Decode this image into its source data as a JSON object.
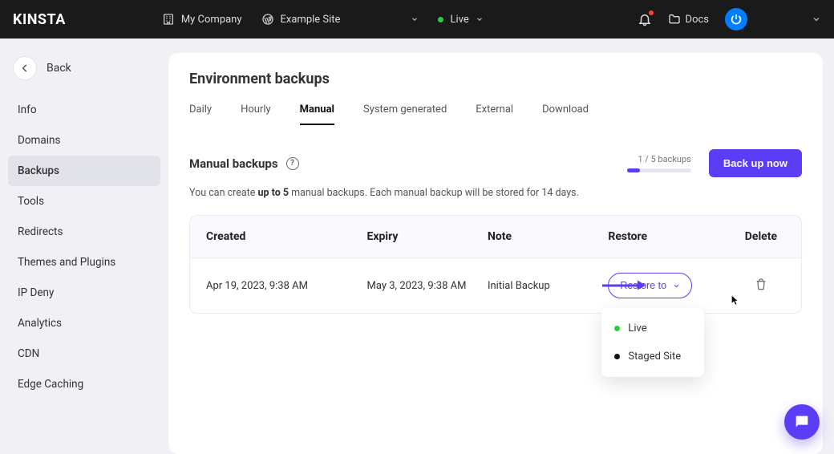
{
  "header": {
    "logo": "KINSTA",
    "company": "My Company",
    "site": "Example Site",
    "env": "Live",
    "docs": "Docs"
  },
  "sidebar": {
    "back": "Back",
    "items": [
      {
        "label": "Info"
      },
      {
        "label": "Domains"
      },
      {
        "label": "Backups",
        "active": true
      },
      {
        "label": "Tools"
      },
      {
        "label": "Redirects"
      },
      {
        "label": "Themes and Plugins"
      },
      {
        "label": "IP Deny"
      },
      {
        "label": "Analytics"
      },
      {
        "label": "CDN"
      },
      {
        "label": "Edge Caching"
      }
    ]
  },
  "page": {
    "title": "Environment backups",
    "tabs": [
      {
        "label": "Daily"
      },
      {
        "label": "Hourly"
      },
      {
        "label": "Manual",
        "active": true
      },
      {
        "label": "System generated"
      },
      {
        "label": "External"
      },
      {
        "label": "Download"
      }
    ],
    "section_title": "Manual backups",
    "counter": "1 / 5 backups",
    "backup_btn": "Back up now",
    "desc_pre": "You can create ",
    "desc_bold": "up to 5",
    "desc_post": " manual backups. Each manual backup will be stored for 14 days."
  },
  "table": {
    "headers": {
      "created": "Created",
      "expiry": "Expiry",
      "note": "Note",
      "restore": "Restore",
      "delete": "Delete"
    },
    "rows": [
      {
        "created": "Apr 19, 2023, 9:38 AM",
        "expiry": "May 3, 2023, 9:38 AM",
        "note": "Initial Backup",
        "restore_label": "Restore to"
      }
    ]
  },
  "dropdown": {
    "live": "Live",
    "staged": "Staged Site"
  }
}
